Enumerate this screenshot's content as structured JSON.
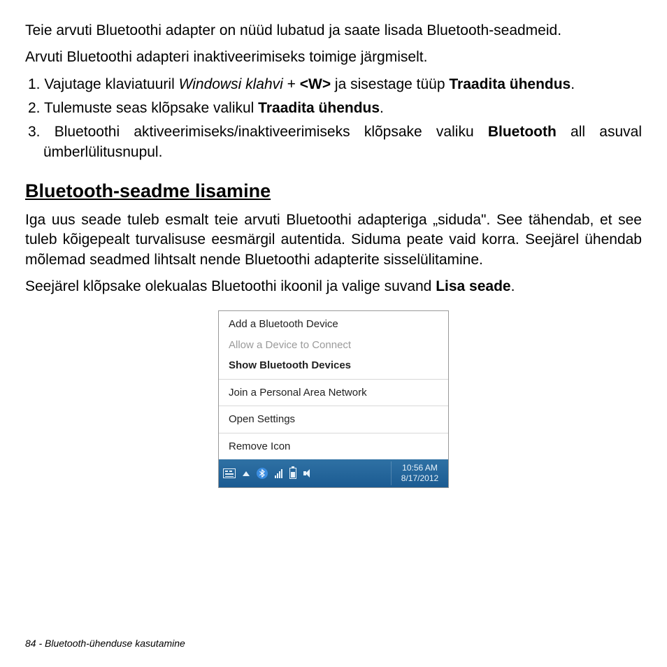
{
  "p1": "Teie arvuti Bluetoothi adapter on nüüd lubatud ja saate lisada Bluetooth-seadmeid.",
  "p2": "Arvuti Bluetoothi adapteri inaktiveerimiseks toimige järgmiselt.",
  "steps": {
    "s1_a": "Vajutage klaviatuuril ",
    "s1_b": "Windowsi klahvi",
    "s1_c": " + ",
    "s1_d": "<W>",
    "s1_e": " ja sisestage tüüp ",
    "s1_f": "Traadita ühendus",
    "s1_g": ".",
    "s2_a": "Tulemuste seas klõpsake valikul ",
    "s2_b": "Traadita ühendus",
    "s2_c": ".",
    "s3_a": "Bluetoothi aktiveerimiseks/inaktiveerimiseks klõpsake valiku ",
    "s3_b": "Bluetooth",
    "s3_c": " all asuval ümberlülitusnupul."
  },
  "heading": "Bluetooth-seadme lisamine",
  "p3": "Iga uus seade tuleb esmalt teie arvuti Bluetoothi adapteriga „siduda\". See tähendab, et see tuleb kõigepealt turvalisuse eesmärgil autentida. Siduma peate vaid korra. Seejärel ühendab mõlemad seadmed lihtsalt nende Bluetoothi adapterite sisselülitamine.",
  "p4_a": "Seejärel klõpsake olekualas Bluetoothi ikoonil ja valige suvand ",
  "p4_b": "Lisa seade",
  "p4_c": ".",
  "menu": {
    "add": "Add a Bluetooth Device",
    "allow": "Allow a Device to Connect",
    "show": "Show Bluetooth Devices",
    "join": "Join a Personal Area Network",
    "open": "Open Settings",
    "remove": "Remove Icon"
  },
  "clock": {
    "time": "10:56 AM",
    "date": "8/17/2012"
  },
  "footer": "84 - Bluetooth-ühenduse kasutamine"
}
